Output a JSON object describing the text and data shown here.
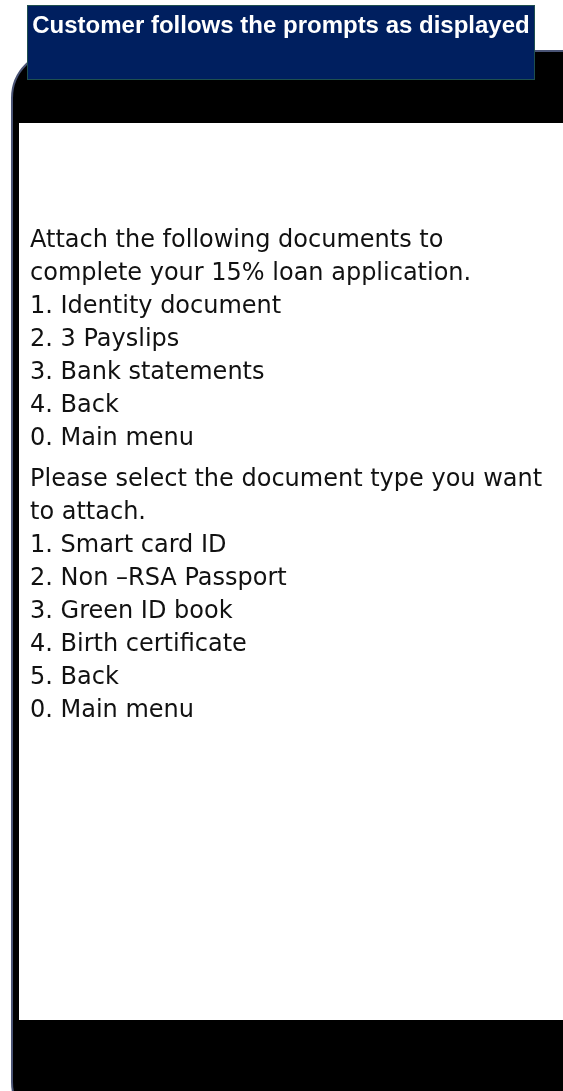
{
  "banner": {
    "title": "Customer follows the prompts as displayed"
  },
  "messages": [
    {
      "prompt": "Attach the following documents to complete your 15% loan application.",
      "options": [
        "1. Identity document",
        "2. 3 Payslips",
        "3. Bank statements",
        "4. Back",
        "0. Main menu"
      ]
    },
    {
      "prompt": "Please select the document type you want to attach.",
      "options": [
        "1. Smart card ID",
        "2. Non –RSA Passport",
        "3. Green ID book",
        "4. Birth certificate",
        "5. Back",
        "0. Main menu"
      ]
    }
  ]
}
